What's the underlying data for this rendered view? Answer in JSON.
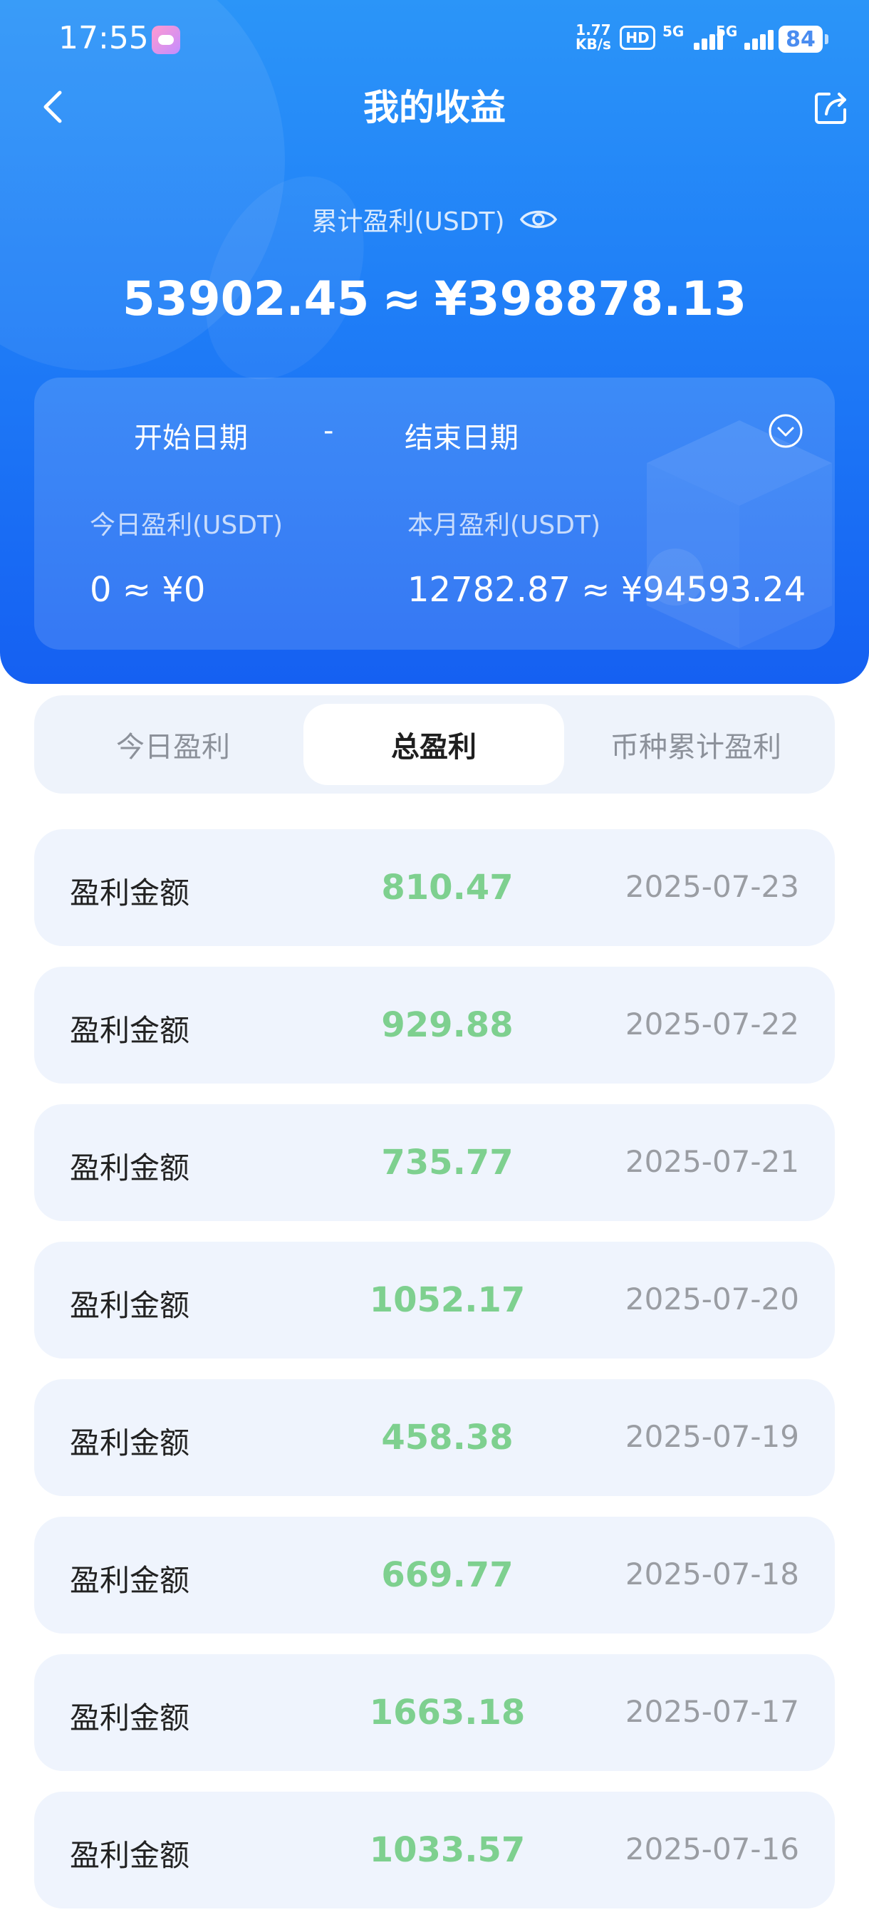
{
  "status_bar": {
    "time": "17:55",
    "speed_value": "1.77",
    "speed_unit": "KB/s",
    "hd_label": "HD",
    "network_1": "5G",
    "network_2": "5G",
    "battery": "84"
  },
  "nav": {
    "title": "我的收益"
  },
  "summary": {
    "label": "累计盈利(USDT)",
    "usdt": "53902.45",
    "approx": "≈",
    "cny": "¥398878.13"
  },
  "date_range": {
    "start": "开始日期",
    "separator": "-",
    "end": "结束日期"
  },
  "stats": {
    "today_label": "今日盈利(USDT)",
    "today_value": "0 ≈ ¥0",
    "month_label": "本月盈利(USDT)",
    "month_value": "12782.87 ≈ ¥94593.24"
  },
  "tabs": [
    {
      "label": "今日盈利",
      "active": false
    },
    {
      "label": "总盈利",
      "active": true
    },
    {
      "label": "币种累计盈利",
      "active": false
    }
  ],
  "records": [
    {
      "label": "盈利金额",
      "amount": "810.47",
      "date": "2025-07-23"
    },
    {
      "label": "盈利金额",
      "amount": "929.88",
      "date": "2025-07-22"
    },
    {
      "label": "盈利金额",
      "amount": "735.77",
      "date": "2025-07-21"
    },
    {
      "label": "盈利金额",
      "amount": "1052.17",
      "date": "2025-07-20"
    },
    {
      "label": "盈利金额",
      "amount": "458.38",
      "date": "2025-07-19"
    },
    {
      "label": "盈利金额",
      "amount": "669.77",
      "date": "2025-07-18"
    },
    {
      "label": "盈利金额",
      "amount": "1663.18",
      "date": "2025-07-17"
    },
    {
      "label": "盈利金额",
      "amount": "1033.57",
      "date": "2025-07-16"
    }
  ],
  "colors": {
    "header_top": "#2b95f8",
    "header_bottom": "#1560f2",
    "amount_green": "#7ed08f",
    "date_gray": "#9a9da3",
    "row_bg": "#eff4fd"
  }
}
